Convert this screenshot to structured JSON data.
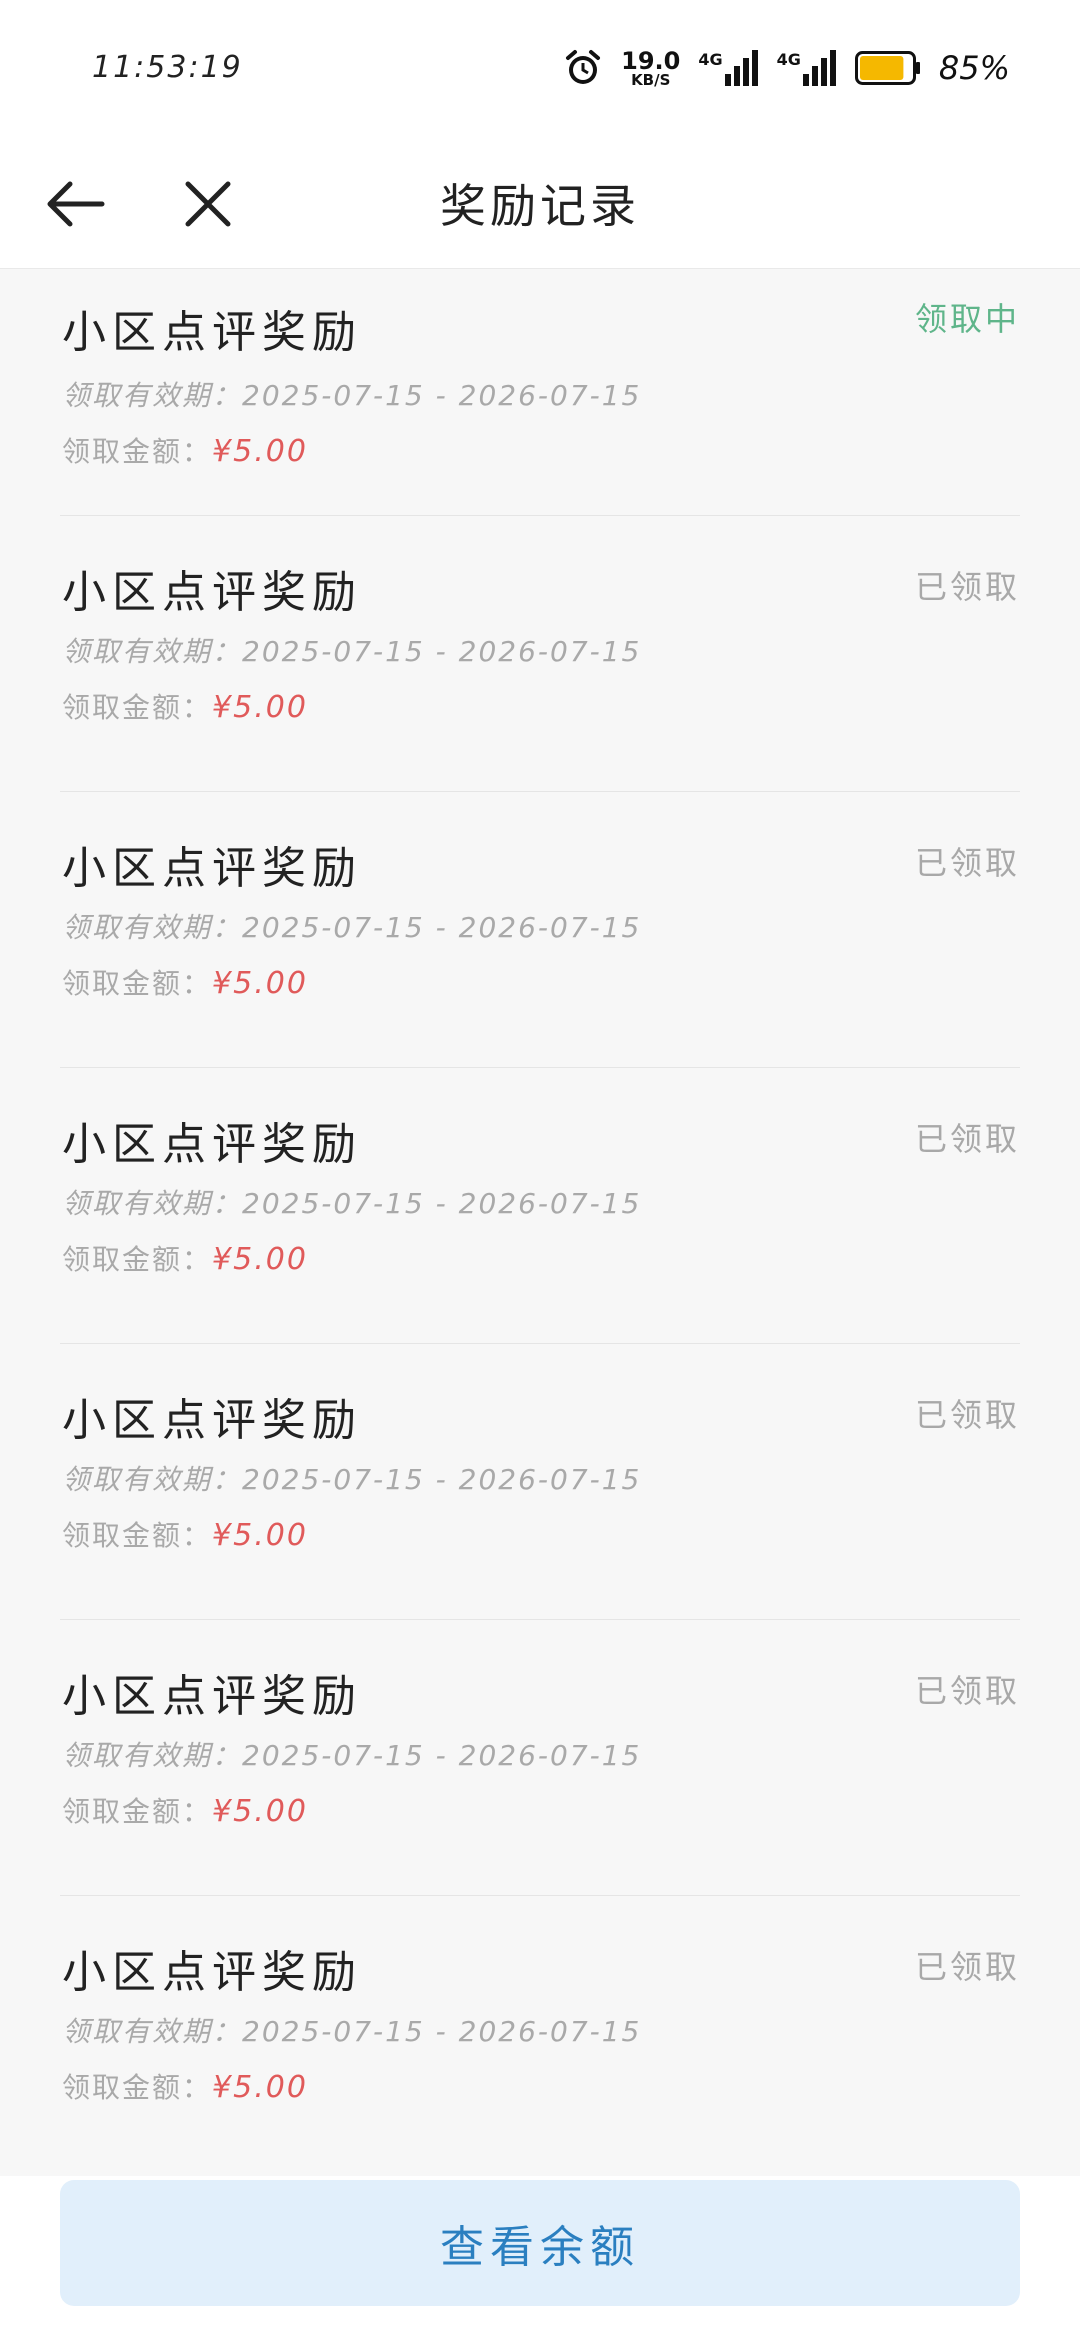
{
  "status_bar": {
    "time": "11:53:19",
    "net_speed": "19.0",
    "net_speed_unit": "KB/S",
    "signal1": "4G",
    "signal2": "4G",
    "battery_level": 0.85,
    "battery_percent": "85%",
    "battery_color": "#f5b800"
  },
  "header": {
    "title": "奖励记录"
  },
  "records": [
    {
      "title": "小区点评奖励",
      "status": "领取中",
      "validity_label": "领取有效期：",
      "validity": "2025-07-15 - 2026-07-15",
      "amount_label": "领取金额：",
      "amount": "¥5.00"
    },
    {
      "title": "小区点评奖励",
      "status": "已领取",
      "validity_label": "领取有效期：",
      "validity": "2025-07-15 - 2026-07-15",
      "amount_label": "领取金额：",
      "amount": "¥5.00"
    },
    {
      "title": "小区点评奖励",
      "status": "已领取",
      "validity_label": "领取有效期：",
      "validity": "2025-07-15 - 2026-07-15",
      "amount_label": "领取金额：",
      "amount": "¥5.00"
    },
    {
      "title": "小区点评奖励",
      "status": "已领取",
      "validity_label": "领取有效期：",
      "validity": "2025-07-15 - 2026-07-15",
      "amount_label": "领取金额：",
      "amount": "¥5.00"
    },
    {
      "title": "小区点评奖励",
      "status": "已领取",
      "validity_label": "领取有效期：",
      "validity": "2025-07-15 - 2026-07-15",
      "amount_label": "领取金额：",
      "amount": "¥5.00"
    },
    {
      "title": "小区点评奖励",
      "status": "已领取",
      "validity_label": "领取有效期：",
      "validity": "2025-07-15 - 2026-07-15",
      "amount_label": "领取金额：",
      "amount": "¥5.00"
    },
    {
      "title": "小区点评奖励",
      "status": "已领取",
      "validity_label": "领取有效期：",
      "validity": "2025-07-15 - 2026-07-15",
      "amount_label": "领取金额：",
      "amount": "¥5.00"
    }
  ],
  "footer": {
    "balance_button": "查看余额"
  },
  "colors": {
    "accent_blue": "#2a7fc0",
    "button_bg": "#e1effb",
    "status_active": "#5fb58a",
    "amount_red": "#e05a5a"
  },
  "icons": {
    "back": "arrow-left-icon",
    "close": "close-icon",
    "alarm": "alarm-clock-icon",
    "signal": "signal-bars-icon",
    "battery": "battery-icon"
  }
}
